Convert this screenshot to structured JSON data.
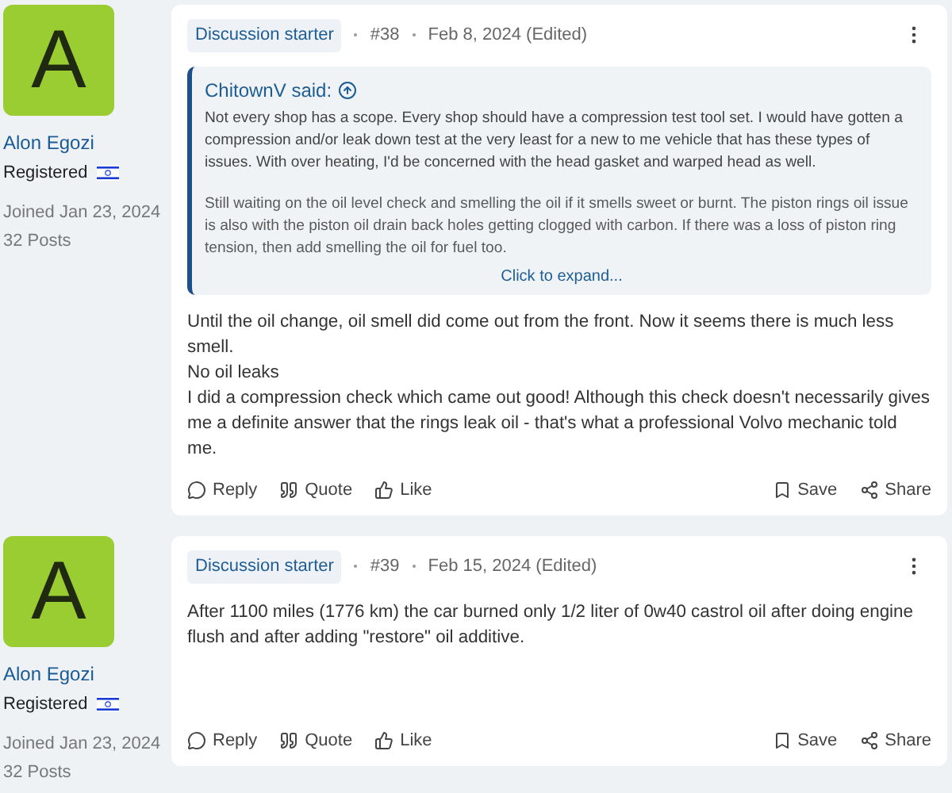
{
  "posts": [
    {
      "author": {
        "initial": "A",
        "name": "Alon Egozi",
        "role": "Registered",
        "joined": "Joined Jan 23, 2024",
        "posts": "32 Posts"
      },
      "badge": "Discussion starter",
      "number": "#38",
      "date": "Feb 8, 2024 (Edited)",
      "quote": {
        "author": "ChitownV said:",
        "paragraphs": [
          "Not every shop has a scope. Every shop should have a compression test tool set. I would have gotten a compression and/or leak down test at the very least for a new to me vehicle that has these types of issues. With over heating, I'd be concerned with the head gasket and warped head as well.",
          "Still waiting on the oil level check and smelling the oil if it smells sweet or burnt. The piston rings oil issue is also with the piston oil drain back holes getting clogged with carbon. If there was a loss of piston ring tension, then add smelling the oil for fuel too."
        ],
        "expand": "Click to expand..."
      },
      "body": [
        "Until the oil change, oil smell did come out from the front. Now it seems there is much less smell.",
        "No oil leaks",
        "I did a compression check which came out good! Although this check doesn't necessarily gives me a definite answer that the rings leak oil - that's what a professional Volvo mechanic told me."
      ],
      "actions": [
        "Reply",
        "Quote",
        "Like"
      ],
      "right_actions": [
        "Save",
        "Share"
      ]
    },
    {
      "author": {
        "initial": "A",
        "name": "Alon Egozi",
        "role": "Registered",
        "joined": "Joined Jan 23, 2024",
        "posts": "32 Posts"
      },
      "badge": "Discussion starter",
      "number": "#39",
      "date": "Feb 15, 2024 (Edited)",
      "body": [
        "After 1100 miles (1776 km) the car burned only 1/2 liter of 0w40 castrol oil after doing engine flush and after adding \"restore\" oil additive."
      ],
      "actions": [
        "Reply",
        "Quote",
        "Like"
      ],
      "right_actions": [
        "Save",
        "Share"
      ]
    }
  ]
}
